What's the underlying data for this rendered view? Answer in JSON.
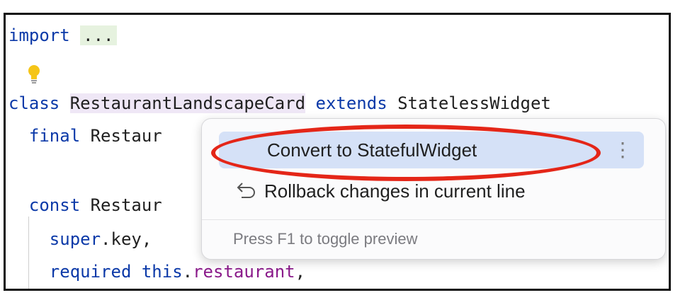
{
  "editor": {
    "line1": {
      "keyword": "import",
      "folded": "..."
    },
    "line3": {
      "keyword": "class",
      "class_name": "RestaurantLandscapeCard",
      "extends_kw": "extends",
      "superclass": "StatelessWidget"
    },
    "line4": {
      "keyword": "final",
      "type": "Restaur"
    },
    "line6": {
      "keyword": "const",
      "name": "Restaur"
    },
    "line7": {
      "keyword": "super",
      "rest": ".key,"
    },
    "line8": {
      "keyword": "required",
      "this_kw": "this",
      "field": "restaurant",
      "tail": ","
    }
  },
  "intention_popup": {
    "items": [
      {
        "label": "Convert to StatefulWidget",
        "selected": true
      },
      {
        "label": "Rollback changes in current line",
        "icon": "undo-icon"
      }
    ],
    "more_icon": "⋮",
    "footer": "Press F1 to toggle preview"
  },
  "colors": {
    "keyword": "#0b39a8",
    "field": "#8a1a8a",
    "selection": "#d5e1f7",
    "highlight_ring": "#e42618",
    "bulb": "#f5c518"
  }
}
